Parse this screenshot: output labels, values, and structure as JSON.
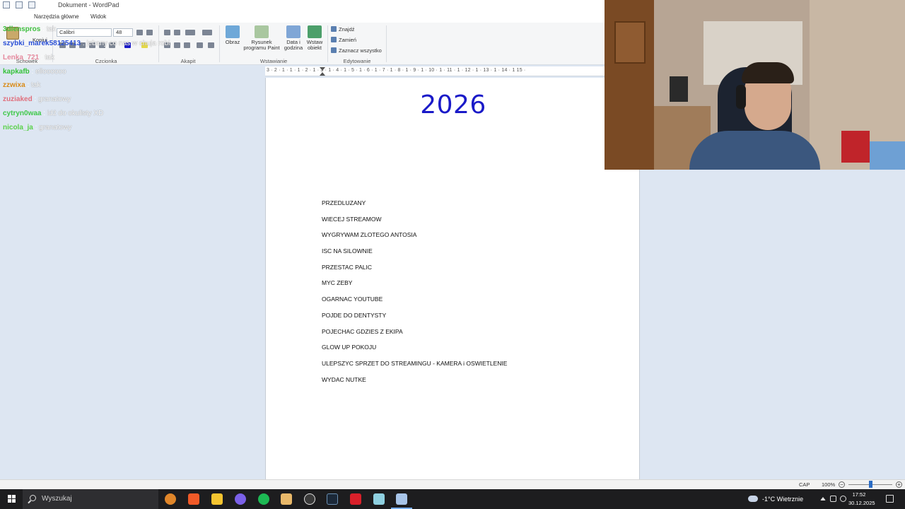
{
  "window": {
    "title": "Dokument - WordPad",
    "tabs": [
      "Narzędzia główne",
      "Widok"
    ]
  },
  "ribbon": {
    "clipboard": {
      "paste_label": "Wklej",
      "copy_label": "Kopiuj",
      "group_label": "Schowek"
    },
    "font": {
      "family": "Calibri",
      "size": "48",
      "group_label": "Czcionka"
    },
    "paragraph": {
      "group_label": "Akapit"
    },
    "insert": {
      "image_label": "Obraz",
      "paint_label_1": "Rysunek",
      "paint_label_2": "programu Paint",
      "datetime_label_1": "Data i",
      "datetime_label_2": "godzina",
      "object_label_1": "Wstaw",
      "object_label_2": "obiekt",
      "group_label": "Wstawianie"
    },
    "editing": {
      "find_label": "Znajdź",
      "replace_label": "Zamień",
      "select_all_label": "Zaznacz wszystko",
      "group_label": "Edytowanie"
    }
  },
  "ruler": {
    "marks": "3 · 2 · 1 · 1 · 1 · 2 · 1 · 3 · 1 · 4 · 1 · 5 · 1 · 6 · 1 · 7 · 1 · 8 · 1 · 9 · 1 · 10 · 1 · 11 · 1 · 12 · 1 · 13 · 1 · 14 · 1 15 ·"
  },
  "document": {
    "title": "2026",
    "items": [
      "PRZEDLUZANY",
      "WIECEJ STREAMOW",
      "WYGRYWAM ZLOTEGO ANTOSIA",
      "ISC NA SILOWNIE",
      "PRZESTAC PALIC",
      "MYC ZEBY",
      "OGARNAC YOUTUBE",
      "POJDE DO DENTYSTY",
      "POJECHAC GDZIES Z EKIPA",
      "GLOW UP POKOJU",
      "ULEPSZYC SPRZET DO STREAMINGU - KAMERA i OSWIETLENIE",
      "WYDAC NUTKE"
    ]
  },
  "chat": {
    "messages": [
      {
        "user": "3dlenspros",
        "text": "tak",
        "color": "#3fbf3f"
      },
      {
        "user": "szybki_marek58125413",
        "text": "jebany co nas w chuja robi",
        "color": "#2a4fd6"
      },
      {
        "user": "Lenka_721",
        "text": "tak",
        "color": "#e58a9e"
      },
      {
        "user": "kapkafb",
        "text": "elloooooo",
        "color": "#36c23a"
      },
      {
        "user": "zzwixa",
        "text": "tak",
        "color": "#d98a16"
      },
      {
        "user": "zuziaked",
        "text": "granatowy",
        "color": "#e0707d"
      },
      {
        "user": "cytryn0waa",
        "text": "idź do okulisty XD",
        "color": "#3fc84a"
      },
      {
        "user": "nicola_ja",
        "text": "granatowy",
        "color": "#5ad14a"
      }
    ]
  },
  "statusbar": {
    "caps": "CAP",
    "zoom": "100%",
    "zoom_level_percent": 100
  },
  "taskbar": {
    "search_placeholder": "Wyszukaj",
    "weather": "-1°C  Wietrznie",
    "time": "17:52",
    "date": "30.12.2025"
  }
}
